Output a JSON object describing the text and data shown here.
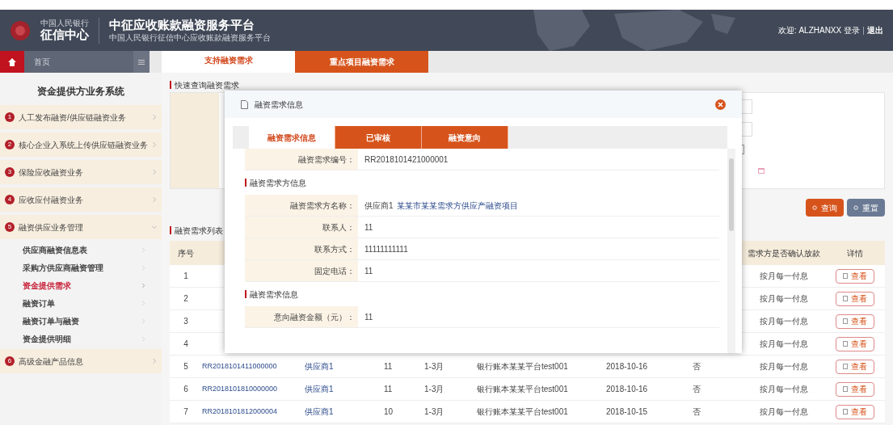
{
  "header": {
    "logo_small": "中国人民银行",
    "logo": "征信中心",
    "title": "中征应收账款融资服务平台",
    "subtitle": "中国人民银行征信中心应收账款融资服务平台",
    "user": "欢迎: ALZHANXX 登录",
    "logout": "退出"
  },
  "nav": {
    "home": "首页"
  },
  "tabs": [
    {
      "label": "支持融资需求",
      "selected": true
    },
    {
      "label": "重点项目融资需求",
      "selected": false
    }
  ],
  "sidebar": {
    "title": "资金提供方业务系统",
    "items": [
      {
        "num": "1",
        "label": "人工发布融资/供应链融资业务",
        "expanded": false
      },
      {
        "num": "2",
        "label": "核心企业入系统上传供应链融资业务",
        "expanded": false
      },
      {
        "num": "3",
        "label": "保险应收融资业务",
        "expanded": false
      },
      {
        "num": "4",
        "label": "应收应付融资业务",
        "expanded": false
      },
      {
        "num": "5",
        "label": "融资供应业务管理",
        "expanded": true,
        "children": [
          {
            "label": "供应商融资信息表",
            "selected": false
          },
          {
            "label": "采购方供应商融资管理",
            "selected": false
          },
          {
            "label": "资金提供需求",
            "selected": true
          },
          {
            "label": "融资订单",
            "selected": false
          },
          {
            "label": "融资订单与融资",
            "selected": false
          },
          {
            "label": "资金提供明细",
            "selected": false
          }
        ]
      },
      {
        "num": "6",
        "label": "高级金融产品信息",
        "expanded": false
      }
    ]
  },
  "query": {
    "title": "快速查询融资需求",
    "buttons": [
      {
        "label": "查询",
        "kind": "primary"
      },
      {
        "label": "重置",
        "kind": "secondary"
      }
    ]
  },
  "list": {
    "title": "融资需求列表",
    "columns": [
      "序号",
      "需求方是否确认放款",
      "详情"
    ],
    "rows": [
      {
        "no": "1",
        "status": "按月每一付息",
        "action": "查看"
      },
      {
        "no": "2",
        "status": "按月每一付息",
        "action": "查看"
      },
      {
        "no": "3",
        "status": "按月每一付息",
        "action": "查看"
      },
      {
        "no": "4",
        "status": "按月每一付息",
        "action": "查看"
      },
      {
        "no": "5",
        "id": "RR2018101411000000",
        "supplier": "供应商1",
        "amount": "11",
        "term": "1-3月",
        "bank": "银行账本某某平台test001",
        "date": "2018-10-16",
        "flag": "否",
        "status": "按月每一付息",
        "action": "查看"
      },
      {
        "no": "6",
        "id": "RR2018101810000000",
        "supplier": "供应商1",
        "amount": "11",
        "term": "1-3月",
        "bank": "银行账本某某平台test001",
        "date": "2018-10-16",
        "flag": "否",
        "status": "按月每一付息",
        "action": "查看"
      },
      {
        "no": "7",
        "id": "RR2018101812000004",
        "supplier": "供应商1",
        "amount": "10",
        "term": "1-3月",
        "bank": "银行账本某某平台test001",
        "date": "2018-10-15",
        "flag": "否",
        "status": "按月每一付息",
        "action": "查看"
      }
    ]
  },
  "modal": {
    "title": "融资需求信息",
    "tabs": [
      {
        "label": "融资需求信息",
        "selected": true
      },
      {
        "label": "已审核",
        "selected": false
      },
      {
        "label": "融资意向",
        "selected": false
      }
    ],
    "sections": [
      {
        "fields": [
          {
            "label": "融资需求编号：",
            "value": "RR2018101421000001"
          }
        ]
      },
      {
        "title": "融资需求方信息",
        "fields": [
          {
            "label": "融资需求方名称：",
            "value": "供应商1",
            "link": "某某市某某需求方供应产融资项目"
          },
          {
            "label": "联系人：",
            "value": "11"
          },
          {
            "label": "联系方式：",
            "value": "11111111111"
          },
          {
            "label": "固定电话：",
            "value": "11"
          }
        ]
      },
      {
        "title": "融资需求信息",
        "fields": [
          {
            "label": "意向融资金额（元）：",
            "value": "11"
          }
        ]
      }
    ]
  }
}
